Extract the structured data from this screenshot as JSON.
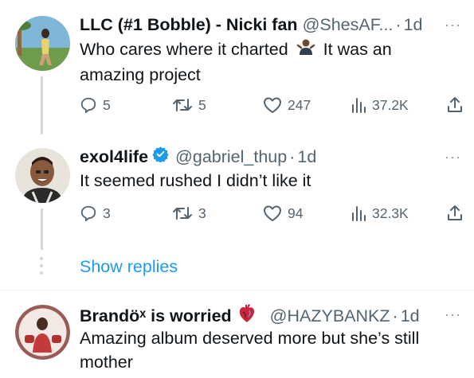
{
  "tweets": [
    {
      "name": "LLC (#1 Bobble) - Nicki fan",
      "handle": "@ShesAF...",
      "dot": "·",
      "time": "1d",
      "text_part1": "Who cares where it charted",
      "text_part2": "It was an amazing project",
      "emoji": "person-shrugging-emoji",
      "reply_count": "5",
      "retweet_count": "5",
      "like_count": "247",
      "view_count": "37.2K"
    },
    {
      "name": "exol4life",
      "verified": true,
      "handle": "@gabriel_thup",
      "dot": "·",
      "time": "1d",
      "text": "It seemed rushed I didn’t like it",
      "reply_count": "3",
      "retweet_count": "3",
      "like_count": "94",
      "view_count": "32.3K"
    },
    {
      "name": "Brandöˣ is worried",
      "emoji": "anatomical-heart-emoji",
      "handle": "@HAZYBANKZ",
      "dot": "·",
      "time": "1d",
      "text": "Amazing album deserved more but she’s still mother"
    }
  ],
  "show_replies_label": "Show replies",
  "more_label": "···",
  "colors": {
    "accent": "#1d9bf0",
    "muted": "#536471",
    "text": "#0f1419",
    "thread_line": "#cfd9de"
  },
  "icons": [
    "reply-icon",
    "retweet-icon",
    "like-icon",
    "views-icon",
    "share-icon",
    "verified-badge-icon",
    "more-icon"
  ]
}
